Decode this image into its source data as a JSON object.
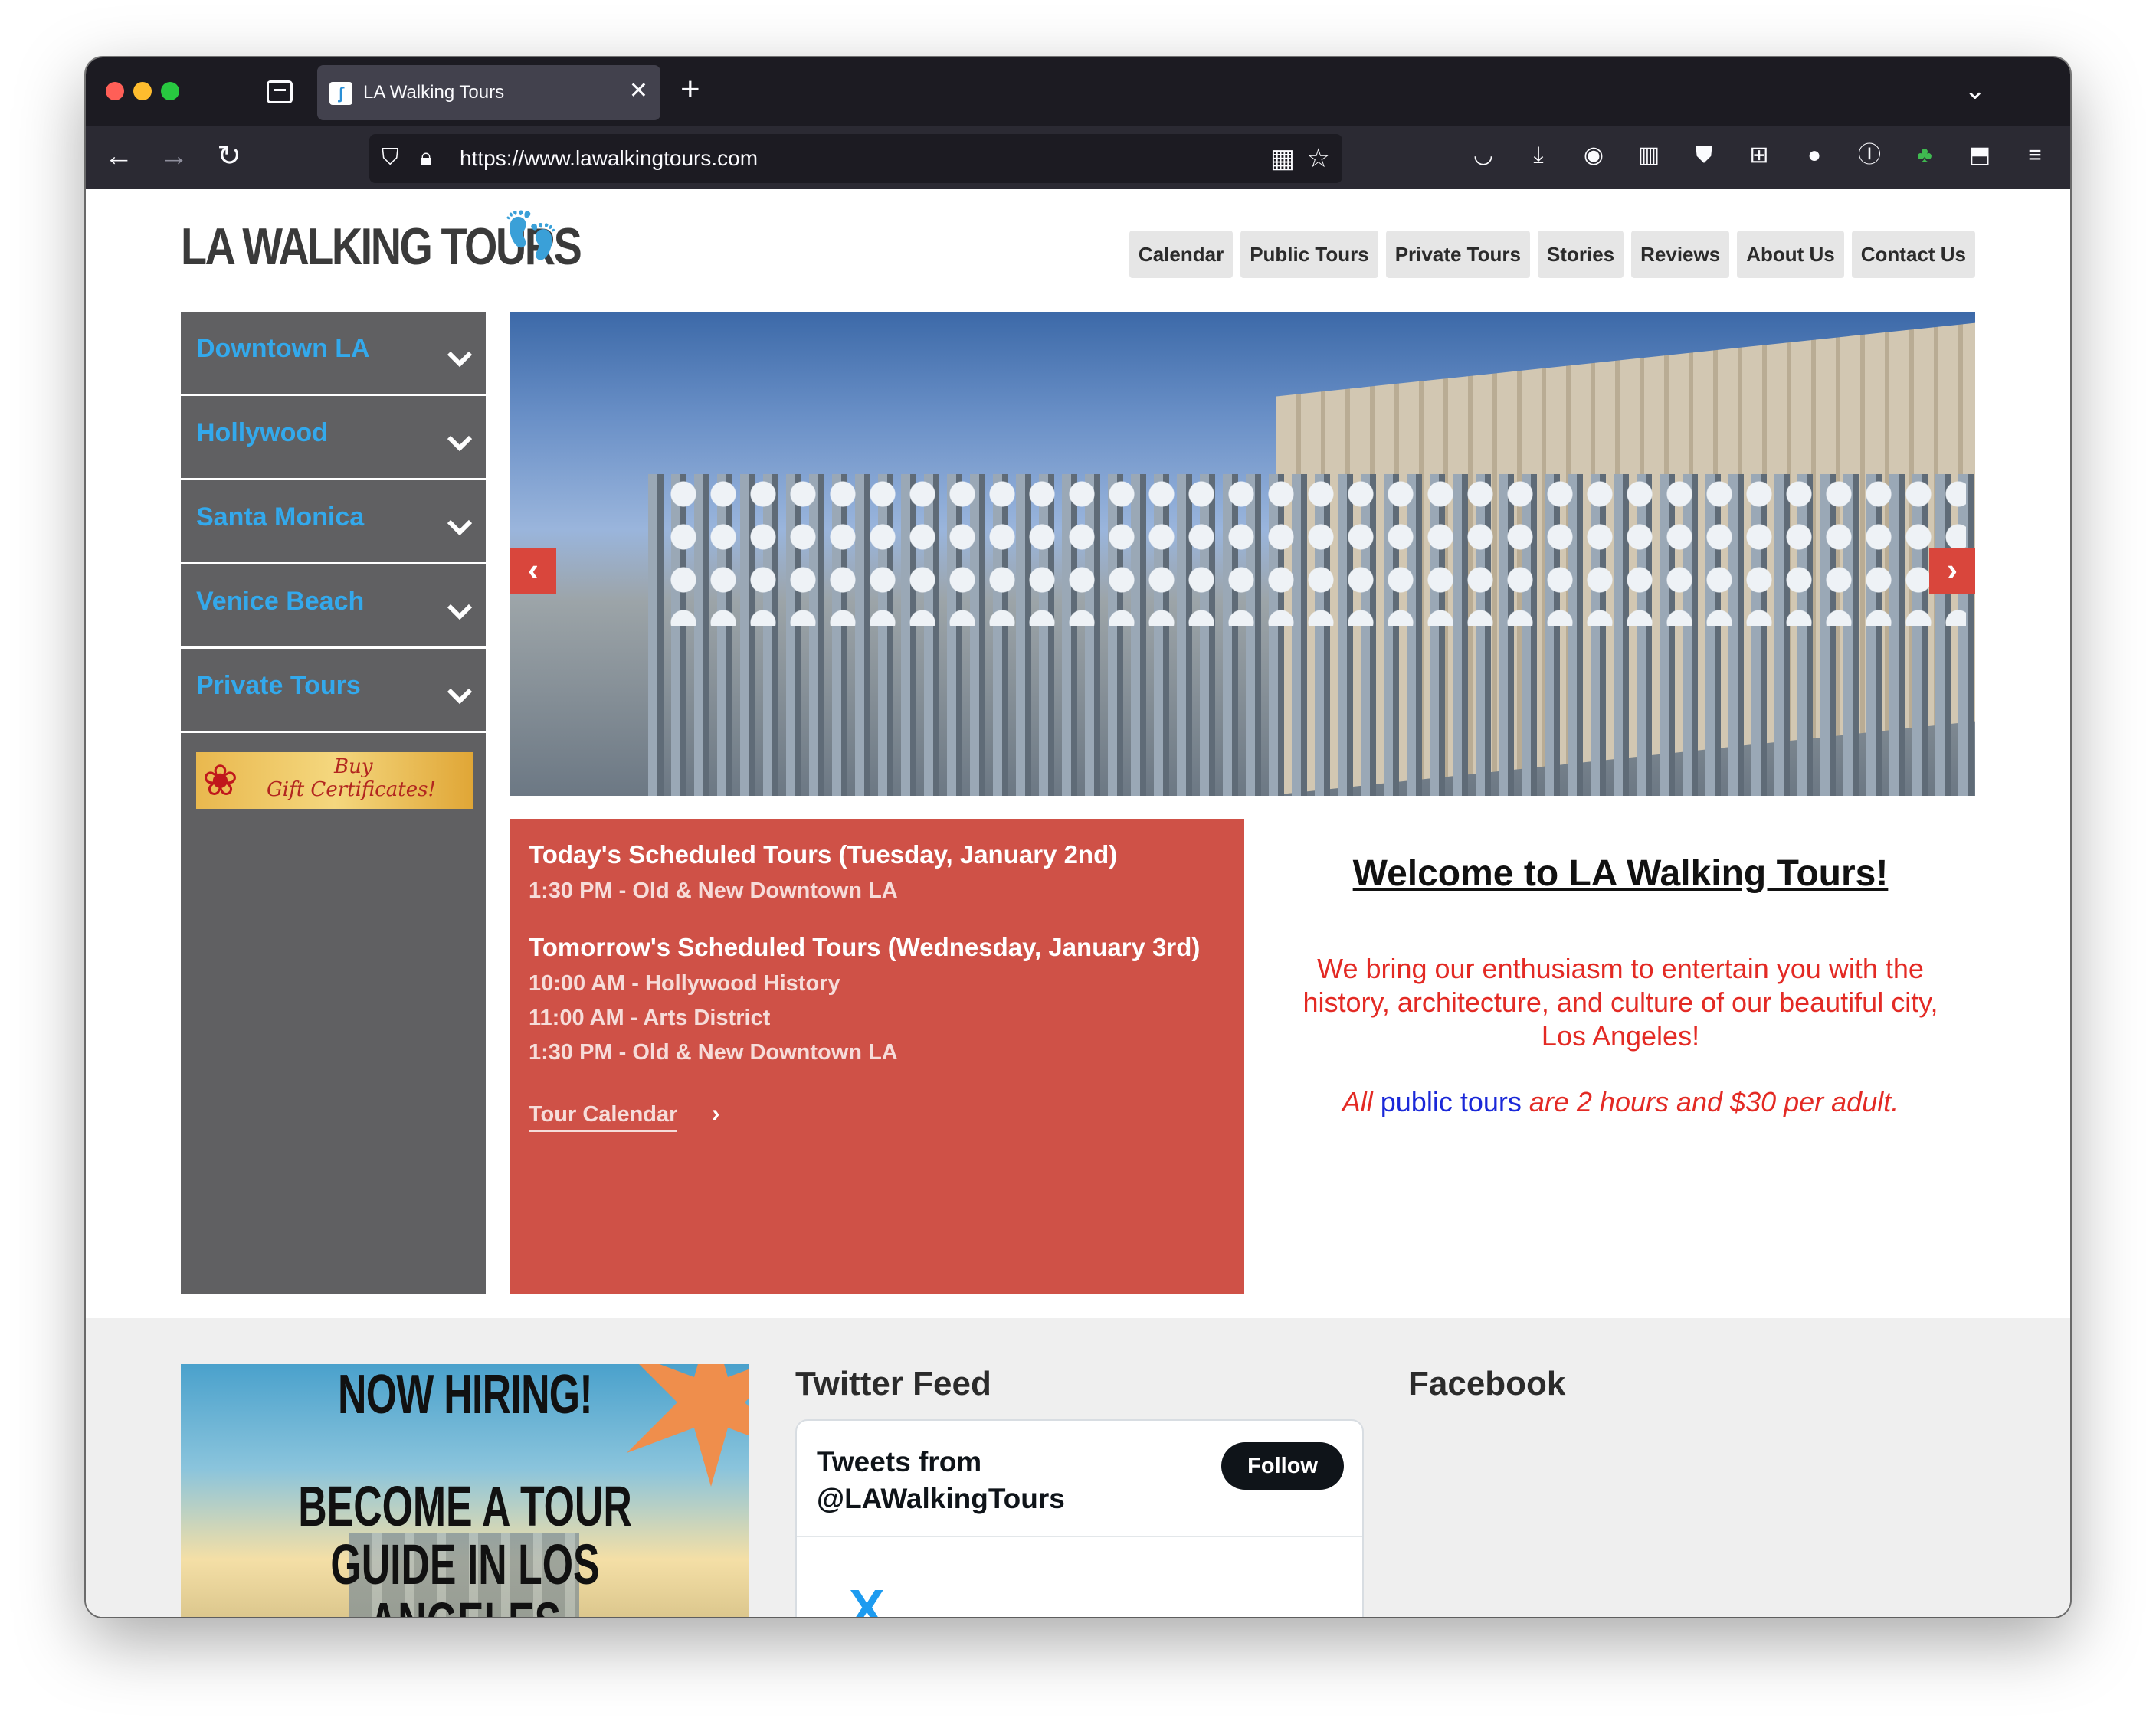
{
  "browser": {
    "tab_title": "LA Walking Tours",
    "url": "https://www.lawalkingtours.com",
    "icons": [
      "tab-list-icon",
      "close-icon",
      "plus-icon",
      "chevron-down-icon",
      "back-icon",
      "forward-icon",
      "reload-icon",
      "shield-icon",
      "lock-icon",
      "qr-icon",
      "star-icon",
      "pocket-icon",
      "download-icon",
      "avatar-icon",
      "extension-icon",
      "menu-icon"
    ]
  },
  "header": {
    "logo_text": "LA WALKING TOURS",
    "nav": [
      "Calendar",
      "Public Tours",
      "Private Tours",
      "Stories",
      "Reviews",
      "About Us",
      "Contact Us"
    ]
  },
  "sidebar": {
    "items": [
      "Downtown LA",
      "Hollywood",
      "Santa Monica",
      "Venice Beach",
      "Private Tours"
    ],
    "gift_line1": "Buy",
    "gift_line2": "Gift Certificates!"
  },
  "schedule": {
    "today_heading": "Today's Scheduled Tours (Tuesday, January 2nd)",
    "today": [
      "1:30 PM - Old & New Downtown LA"
    ],
    "tomorrow_heading": "Tomorrow's Scheduled Tours (Wednesday, January 3rd)",
    "tomorrow": [
      "10:00 AM - Hollywood History",
      "11:00 AM - Arts District",
      "1:30 PM - Old & New Downtown LA"
    ],
    "link": "Tour Calendar"
  },
  "welcome": {
    "title": "Welcome to LA Walking Tours!",
    "text": "We bring our enthusiasm to entertain you with the history, architecture, and culture of our beautiful city, Los Angeles!",
    "price_pre": "All ",
    "price_link": "public tours",
    "price_post": " are 2 hours and $30 per adult."
  },
  "footer": {
    "hiring_title": "NOW HIRING!",
    "hiring_sub": "BECOME A TOUR GUIDE IN LOS ANGELES",
    "twitter_title": "Twitter Feed",
    "tweets_from": "Tweets from @LAWalkingTours",
    "follow": "Follow",
    "facebook_title": "Facebook"
  },
  "colors": {
    "sidebar_bg": "#606062",
    "sidebar_link": "#33a9ec",
    "schedule_bg": "#cf5147",
    "welcome_text": "#e32a24",
    "link_blue": "#1a28d8"
  }
}
